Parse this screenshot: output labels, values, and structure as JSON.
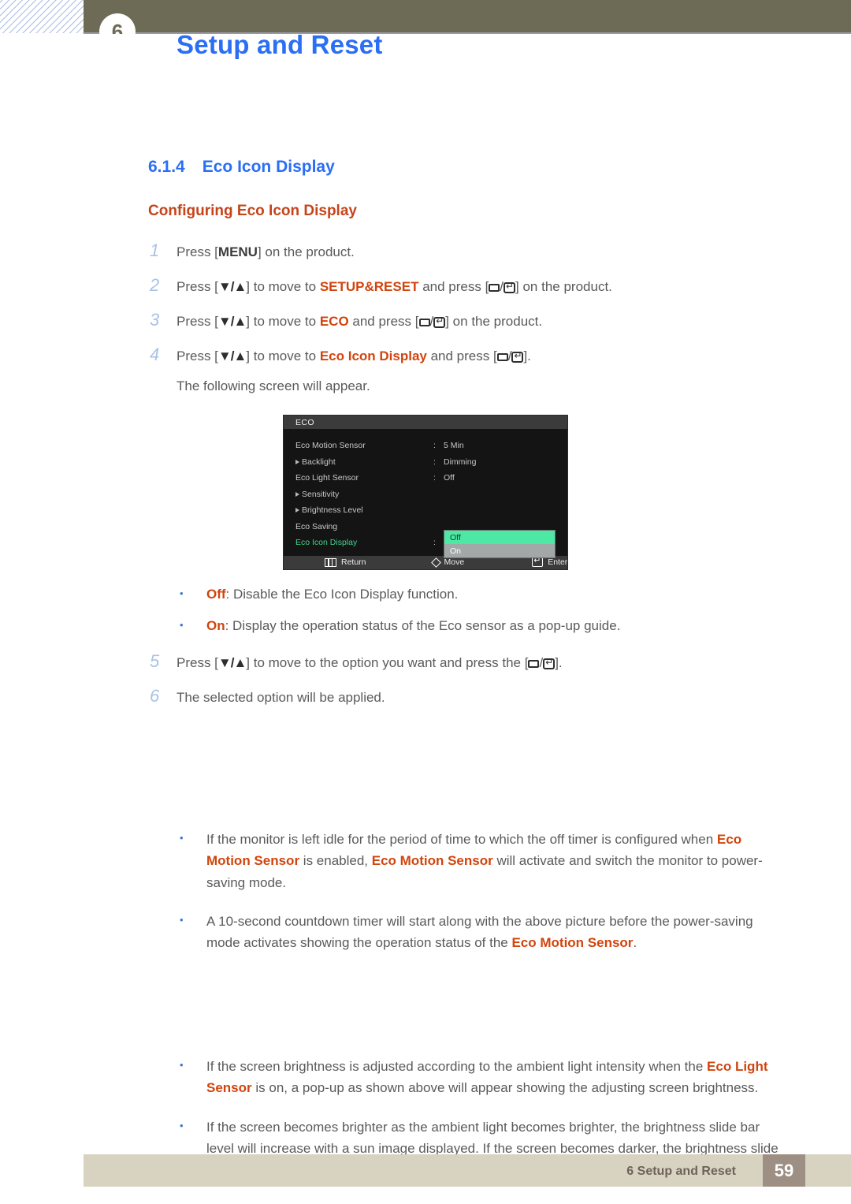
{
  "header": {
    "chapter_number": "6",
    "title": "Setup and Reset"
  },
  "section": {
    "number": "6.1.4",
    "title": "Eco Icon Display",
    "subtitle": "Configuring Eco Icon Display"
  },
  "steps": [
    {
      "num": "1",
      "parts": [
        {
          "t": "Press [",
          "s": "plain"
        },
        {
          "t": "MENU",
          "s": "bold"
        },
        {
          "t": "] on the product.",
          "s": "plain"
        }
      ]
    },
    {
      "num": "2",
      "parts": [
        {
          "t": "Press [",
          "s": "plain"
        },
        {
          "t": "▼/▲",
          "s": "arrow"
        },
        {
          "t": "] to move to ",
          "s": "plain"
        },
        {
          "t": "SETUP&RESET",
          "s": "keyword"
        },
        {
          "t": " and press [",
          "s": "plain"
        },
        {
          "t": "RECT",
          "s": "glyph-rect"
        },
        {
          "t": "/",
          "s": "plain"
        },
        {
          "t": "ENTER",
          "s": "glyph-enter"
        },
        {
          "t": "] on the product.",
          "s": "plain"
        }
      ]
    },
    {
      "num": "3",
      "parts": [
        {
          "t": "Press [",
          "s": "plain"
        },
        {
          "t": "▼/▲",
          "s": "arrow"
        },
        {
          "t": "] to move to ",
          "s": "plain"
        },
        {
          "t": "ECO",
          "s": "keyword"
        },
        {
          "t": " and press [",
          "s": "plain"
        },
        {
          "t": "RECT",
          "s": "glyph-rect"
        },
        {
          "t": "/",
          "s": "plain"
        },
        {
          "t": "ENTER",
          "s": "glyph-enter"
        },
        {
          "t": "] on the product.",
          "s": "plain"
        }
      ]
    },
    {
      "num": "4",
      "parts": [
        {
          "t": "Press [",
          "s": "plain"
        },
        {
          "t": "▼/▲",
          "s": "arrow"
        },
        {
          "t": "] to move to ",
          "s": "plain"
        },
        {
          "t": "Eco Icon Display",
          "s": "keyword"
        },
        {
          "t": " and press [",
          "s": "plain"
        },
        {
          "t": "RECT",
          "s": "glyph-rect"
        },
        {
          "t": "/",
          "s": "plain"
        },
        {
          "t": "ENTER",
          "s": "glyph-enter"
        },
        {
          "t": "].",
          "s": "plain"
        }
      ]
    }
  ],
  "following_screen_text": "The following screen will appear.",
  "osd": {
    "title": "ECO",
    "rows": [
      {
        "label": "Eco Motion Sensor",
        "arrow": false,
        "colon": ":",
        "value": "5 Min",
        "selected": false
      },
      {
        "label": "Backlight",
        "arrow": true,
        "colon": ":",
        "value": "Dimming",
        "selected": false
      },
      {
        "label": "Eco Light Sensor",
        "arrow": false,
        "colon": ":",
        "value": "Off",
        "selected": false
      },
      {
        "label": "Sensitivity",
        "arrow": true,
        "colon": "",
        "value": "",
        "selected": false
      },
      {
        "label": "Brightness Level",
        "arrow": true,
        "colon": "",
        "value": "",
        "selected": false
      },
      {
        "label": "Eco Saving",
        "arrow": false,
        "colon": "",
        "value": "",
        "selected": false
      },
      {
        "label": "Eco Icon Display",
        "arrow": false,
        "colon": ":",
        "value": "",
        "selected": true
      }
    ],
    "popup": {
      "active_option": "Off",
      "inactive_option": "On"
    },
    "footer": {
      "return_label": "Return",
      "move_label": "Move",
      "enter_label": "Enter"
    },
    "colors": {
      "highlight": "#4ce8a4",
      "inactive": "#a2a7a7",
      "selected_label": "#41d38a",
      "background": "#141414",
      "bar": "#3b3b3b"
    }
  },
  "option_bullets": [
    {
      "parts": [
        {
          "t": "Off",
          "s": "keyword"
        },
        {
          "t": ": Disable the Eco Icon Display function.",
          "s": "plain"
        }
      ]
    },
    {
      "parts": [
        {
          "t": "On",
          "s": "keyword"
        },
        {
          "t": ": Display the operation status of the Eco sensor as a pop-up guide.",
          "s": "plain"
        }
      ]
    }
  ],
  "steps_after": [
    {
      "num": "5",
      "parts": [
        {
          "t": "Press [",
          "s": "plain"
        },
        {
          "t": "▼/▲",
          "s": "arrow"
        },
        {
          "t": "] to move to the option you want and press the [",
          "s": "plain"
        },
        {
          "t": "RECT",
          "s": "glyph-rect"
        },
        {
          "t": "/",
          "s": "plain"
        },
        {
          "t": "ENTER",
          "s": "glyph-enter"
        },
        {
          "t": "].",
          "s": "plain"
        }
      ]
    },
    {
      "num": "6",
      "parts": [
        {
          "t": "The selected option will be applied.",
          "s": "plain"
        }
      ]
    }
  ],
  "notes_group_1": [
    {
      "parts": [
        {
          "t": "If the monitor is left idle for the period of time to which the off timer is configured when ",
          "s": "plain"
        },
        {
          "t": "Eco Motion Sensor",
          "s": "keyword"
        },
        {
          "t": " is enabled, ",
          "s": "plain"
        },
        {
          "t": "Eco Motion Sensor",
          "s": "keyword"
        },
        {
          "t": " will activate and switch the monitor to power-saving mode.",
          "s": "plain"
        }
      ]
    },
    {
      "parts": [
        {
          "t": "A 10-second countdown timer will start along with the above picture before the power-saving mode activates showing the operation status of the ",
          "s": "plain"
        },
        {
          "t": "Eco Motion Sensor",
          "s": "keyword"
        },
        {
          "t": ".",
          "s": "plain"
        }
      ]
    }
  ],
  "notes_group_2": [
    {
      "parts": [
        {
          "t": "If the screen brightness is adjusted according to the ambient light intensity when the ",
          "s": "plain"
        },
        {
          "t": "Eco Light Sensor",
          "s": "keyword"
        },
        {
          "t": " is on, a pop-up as shown above will appear showing the adjusting screen brightness.",
          "s": "plain"
        }
      ]
    },
    {
      "parts": [
        {
          "t": "If the screen becomes brighter as the ambient light becomes brighter, the brightness slide bar level will increase with a sun image displayed. If the screen becomes darker, the brightness slide",
          "s": "plain"
        }
      ]
    }
  ],
  "footer": {
    "text": "6 Setup and Reset",
    "page_number": "59"
  }
}
